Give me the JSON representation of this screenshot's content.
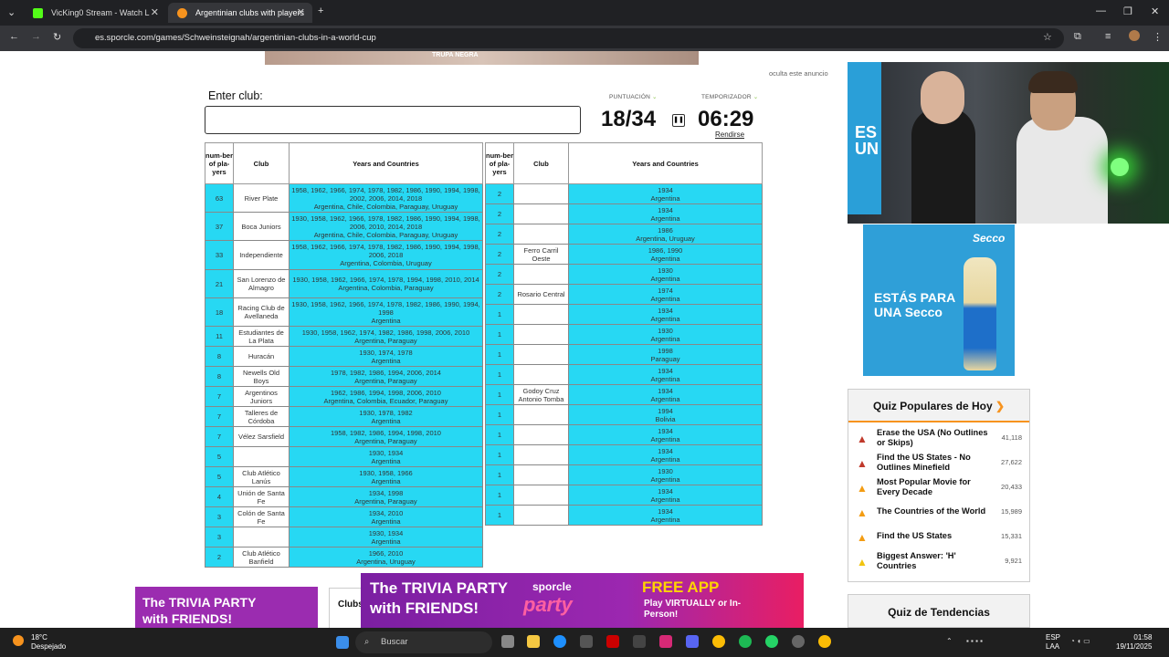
{
  "browser": {
    "tabs": [
      {
        "label": "VicKing0 Stream - Watch L"
      },
      {
        "label": "Argentinian clubs with players"
      }
    ],
    "url": "es.sporcle.com/games/Schweinsteignah/argentinian-clubs-in-a-world-cup"
  },
  "ad": {
    "hide_label": "oculta este anuncio",
    "banner_text": "TRUPA NEGRA"
  },
  "quiz": {
    "enter_label": "Enter club:",
    "input_value": "",
    "score_label": "PUNTUACIÓN",
    "timer_label": "TEMPORIZADOR",
    "score": "18/34",
    "timer": "06:29",
    "give_up": "Rendirse",
    "headers": [
      "num-ber of pla-yers",
      "Club",
      "Years and Countries"
    ],
    "left_rows": [
      {
        "n": "63",
        "club": "River Plate",
        "years": "1958, 1962, 1966, 1974, 1978, 1982, 1986, 1990, 1994, 1998, 2002, 2006, 2014, 2018",
        "countries": "Argentina, Chile, Colombia, Paraguay, Uruguay"
      },
      {
        "n": "37",
        "club": "Boca Juniors",
        "years": "1930, 1958, 1962, 1966, 1978, 1982, 1986, 1990, 1994, 1998, 2006, 2010, 2014, 2018",
        "countries": "Argentina, Chile, Colombia, Paraguay, Uruguay"
      },
      {
        "n": "33",
        "club": "Independiente",
        "years": "1958, 1962, 1966, 1974, 1978, 1982, 1986, 1990, 1994, 1998, 2006, 2018",
        "countries": "Argentina, Colombia, Uruguay"
      },
      {
        "n": "21",
        "club": "San Lorenzo de Almagro",
        "years": "1930, 1958, 1962, 1966, 1974, 1978, 1994, 1998, 2010, 2014",
        "countries": "Argentina, Colombia, Paraguay"
      },
      {
        "n": "18",
        "club": "Racing Club de Avellaneda",
        "years": "1930, 1958, 1962, 1966, 1974, 1978, 1982, 1986, 1990, 1994, 1998",
        "countries": "Argentina"
      },
      {
        "n": "11",
        "club": "Estudiantes de La Plata",
        "years": "1930, 1958, 1962, 1974, 1982, 1986, 1998, 2006, 2010",
        "countries": "Argentina, Paraguay"
      },
      {
        "n": "8",
        "club": "Huracán",
        "years": "1930, 1974, 1978",
        "countries": "Argentina"
      },
      {
        "n": "8",
        "club": "Newells Old Boys",
        "years": "1978, 1982, 1986, 1994, 2006, 2014",
        "countries": "Argentina, Paraguay"
      },
      {
        "n": "7",
        "club": "Argentinos Juniors",
        "years": "1962, 1986, 1994, 1998, 2006, 2010",
        "countries": "Argentina, Colombia, Ecuador, Paraguay"
      },
      {
        "n": "7",
        "club": "Talleres de Córdoba",
        "years": "1930, 1978, 1982",
        "countries": "Argentina"
      },
      {
        "n": "7",
        "club": "Vélez Sarsfield",
        "years": "1958, 1982, 1986, 1994, 1998, 2010",
        "countries": "Argentina, Paraguay"
      },
      {
        "n": "5",
        "club": "",
        "years": "1930, 1934",
        "countries": "Argentina"
      },
      {
        "n": "5",
        "club": "Club Atlético Lanús",
        "years": "1930, 1958, 1966",
        "countries": "Argentina"
      },
      {
        "n": "4",
        "club": "Unión de Santa Fe",
        "years": "1934, 1998",
        "countries": "Argentina, Paraguay"
      },
      {
        "n": "3",
        "club": "Colón de Santa Fe",
        "years": "1934, 2010",
        "countries": "Argentina"
      },
      {
        "n": "3",
        "club": "",
        "years": "1930, 1934",
        "countries": "Argentina"
      },
      {
        "n": "2",
        "club": "Club Atlético Banfield",
        "years": "1966, 2010",
        "countries": "Argentina, Uruguay"
      }
    ],
    "right_rows": [
      {
        "n": "2",
        "club": "",
        "years": "1934",
        "countries": "Argentina"
      },
      {
        "n": "2",
        "club": "",
        "years": "1934",
        "countries": "Argentina"
      },
      {
        "n": "2",
        "club": "",
        "years": "1986",
        "countries": "Argentina, Uruguay"
      },
      {
        "n": "2",
        "club": "Ferro Carril Oeste",
        "years": "1986, 1990",
        "countries": "Argentina"
      },
      {
        "n": "2",
        "club": "",
        "years": "1930",
        "countries": "Argentina"
      },
      {
        "n": "2",
        "club": "Rosario Central",
        "years": "1974",
        "countries": "Argentina"
      },
      {
        "n": "1",
        "club": "",
        "years": "1934",
        "countries": "Argentina"
      },
      {
        "n": "1",
        "club": "",
        "years": "1930",
        "countries": "Argentina"
      },
      {
        "n": "1",
        "club": "",
        "years": "1998",
        "countries": "Paraguay"
      },
      {
        "n": "1",
        "club": "",
        "years": "1934",
        "countries": "Argentina"
      },
      {
        "n": "1",
        "club": "Godoy Cruz Antonio Tomba",
        "years": "1934",
        "countries": "Argentina"
      },
      {
        "n": "1",
        "club": "",
        "years": "1994",
        "countries": "Bolivia"
      },
      {
        "n": "1",
        "club": "",
        "years": "1934",
        "countries": "Argentina"
      },
      {
        "n": "1",
        "club": "",
        "years": "1934",
        "countries": "Argentina"
      },
      {
        "n": "1",
        "club": "",
        "years": "1930",
        "countries": "Argentina"
      },
      {
        "n": "1",
        "club": "",
        "years": "1934",
        "countries": "Argentina"
      },
      {
        "n": "1",
        "club": "",
        "years": "1934",
        "countries": "Argentina"
      }
    ]
  },
  "popular": {
    "title": "Quiz Populares de Hoy",
    "items": [
      {
        "name": "Erase the USA (No Outlines or Skips)",
        "count": "41,118"
      },
      {
        "name": "Find the US States - No Outlines Minefield",
        "count": "27,622"
      },
      {
        "name": "Most Popular Movie for Every Decade",
        "count": "20,433"
      },
      {
        "name": "The Countries of the World",
        "count": "15,989"
      },
      {
        "name": "Find the US States",
        "count": "15,331"
      },
      {
        "name": "Biggest Answer: 'H' Countries",
        "count": "9,921"
      }
    ],
    "trending_title": "Quiz de Tendencias"
  },
  "ads": {
    "secco_text": "ESTÁS PARA UNA Secco",
    "secco_brand": "Secco",
    "cam_text": "ES UN",
    "trivia_left_1": "The TRIVIA PARTY",
    "trivia_left_2": "with FRIENDS!",
    "trivia_main_1": "The TRIVIA PARTY",
    "trivia_main_2": "with FRIENDS!",
    "sporcle": "sporcle",
    "party": "party",
    "free_app": "FREE APP",
    "play": "Play VIRTUALLY or In-Person!",
    "clubs_tab": "Clubs"
  },
  "taskbar": {
    "temp": "18°C",
    "weather": "Despejado",
    "search": "Buscar",
    "lang1": "ESP",
    "lang2": "LAA",
    "time": "01:58",
    "date": "19/11/2025"
  }
}
